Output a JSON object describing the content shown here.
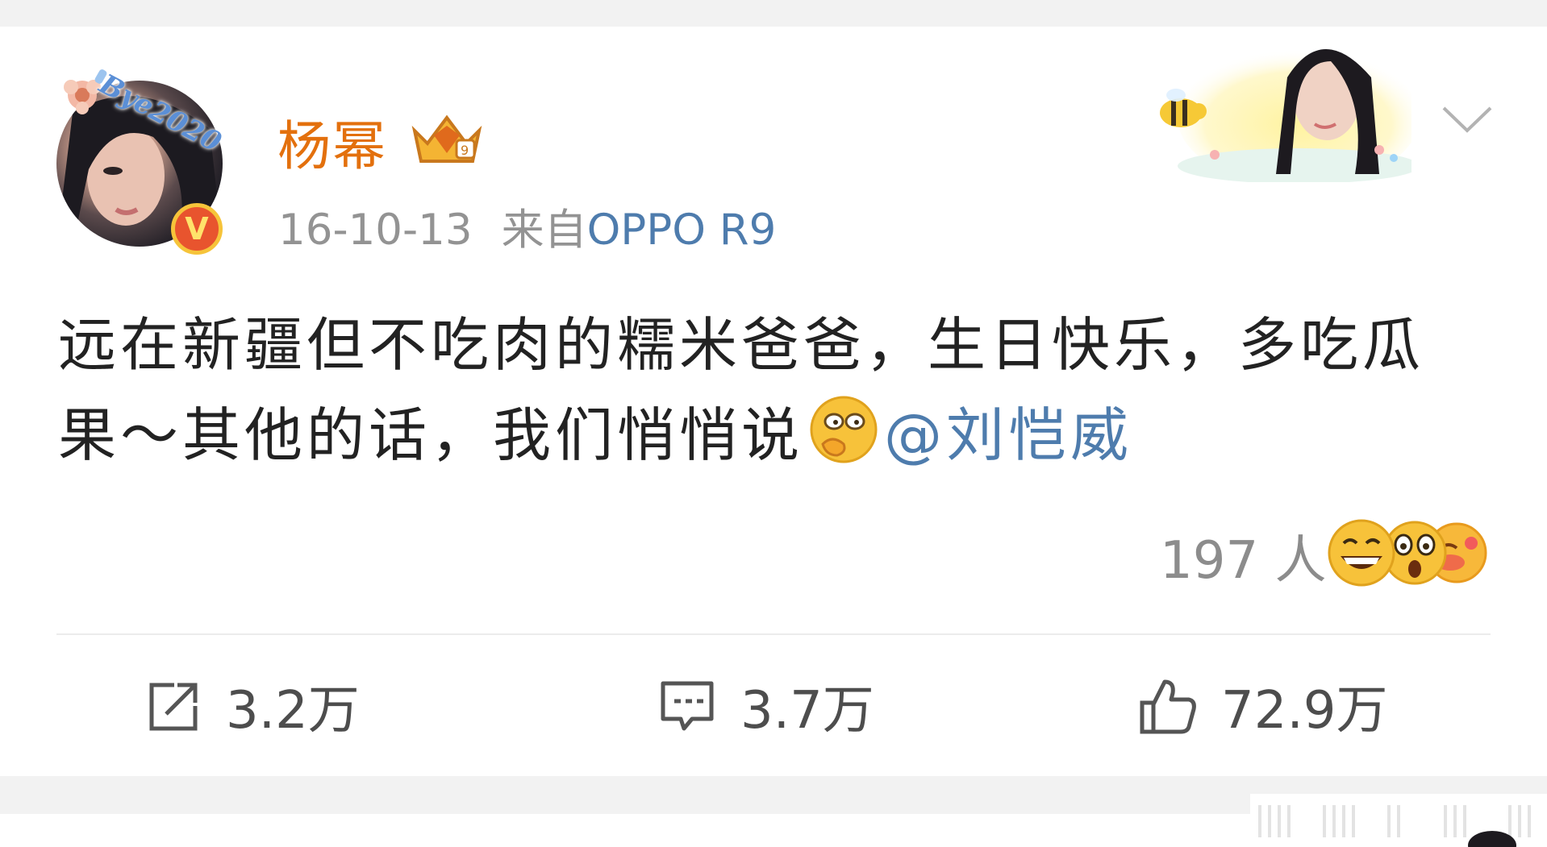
{
  "post": {
    "author": {
      "name": "杨幂",
      "avatar_sticker_text": "Bye2020",
      "verified_badge": "V",
      "badge_icon": "crown-icon"
    },
    "date": "16-10-13",
    "source_prefix": "来自",
    "source": "OPPO R9",
    "text": {
      "line1": "远在新疆但不吃肉的糯米爸爸，生日快乐，多吃瓜",
      "line2": "果～其他的话，我们悄悄说",
      "inline_emoji": "shy-peek-emoji",
      "mention": "@刘恺威"
    },
    "reactions": {
      "count": "197 人",
      "emojis": [
        "laughing-emoji",
        "shocked-emoji",
        "blush-emoji"
      ]
    },
    "actions": {
      "repost": "3.2万",
      "comment": "3.7万",
      "like": "72.9万"
    }
  },
  "colors": {
    "username": "#e3700d",
    "link": "#4e7cad",
    "meta": "#939393",
    "text": "#222222"
  }
}
